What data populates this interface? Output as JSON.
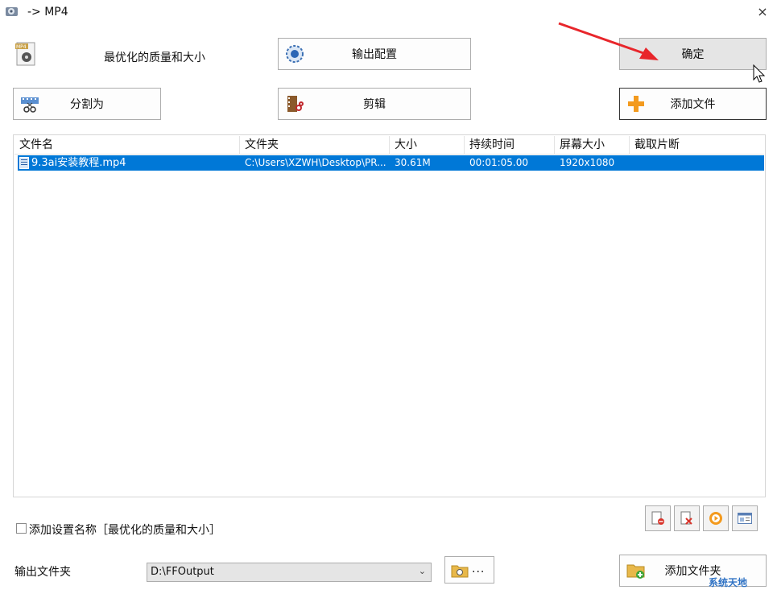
{
  "window": {
    "title": "-> MP4",
    "close_symbol": "×"
  },
  "profile": {
    "label": "最优化的质量和大小"
  },
  "buttons": {
    "output_config": "输出配置",
    "ok": "确定",
    "split": "分割为",
    "edit": "剪辑",
    "add_file": "添加文件",
    "add_folder": "添加文件夹"
  },
  "file_list": {
    "columns": [
      "文件名",
      "文件夹",
      "大小",
      "持续时间",
      "屏幕大小",
      "截取片断"
    ],
    "rows": [
      {
        "name": "9.3ai安装教程.mp4",
        "folder": "C:\\Users\\XZWH\\Desktop\\PR...",
        "size": "30.61M",
        "duration": "00:01:05.00",
        "screen": "1920x1080",
        "clip": ""
      }
    ]
  },
  "options": {
    "add_setting_name": "添加设置名称［最优化的质量和大小］"
  },
  "output": {
    "label": "输出文件夹",
    "folder": "D:\\FFOutput",
    "browse": "..."
  },
  "watermark": "系统天地",
  "colors": {
    "selection": "#0078d7",
    "arrow": "#e8262b",
    "button_face": "#fdfdfd"
  }
}
